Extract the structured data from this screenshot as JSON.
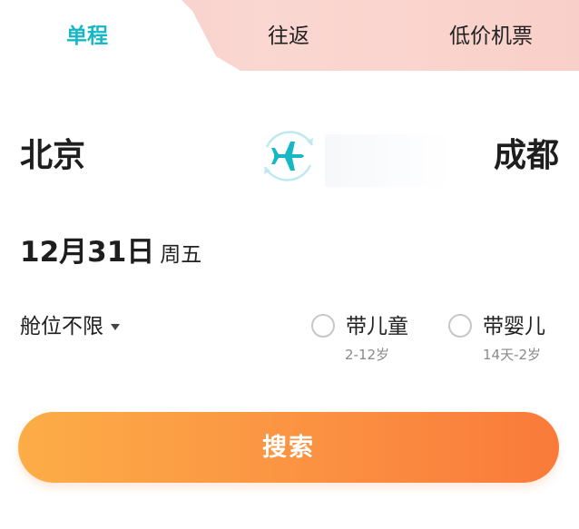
{
  "tabs": {
    "single": "单程",
    "round": "往返",
    "lowfare": "低价机票"
  },
  "route": {
    "from": "北京",
    "to": "成都",
    "swap_icon": "plane-swap-icon"
  },
  "date": {
    "main": "12月31日",
    "weekday": "周五"
  },
  "cabin": {
    "label": "舱位不限"
  },
  "options": {
    "child_label": "带儿童",
    "child_sub": "2-12岁",
    "infant_label": "带婴儿",
    "infant_sub": "14天-2岁"
  },
  "search": {
    "label": "搜索"
  },
  "colors": {
    "accent": "#17b8c6",
    "button_start": "#fcad47",
    "button_end": "#fa7a3a"
  }
}
